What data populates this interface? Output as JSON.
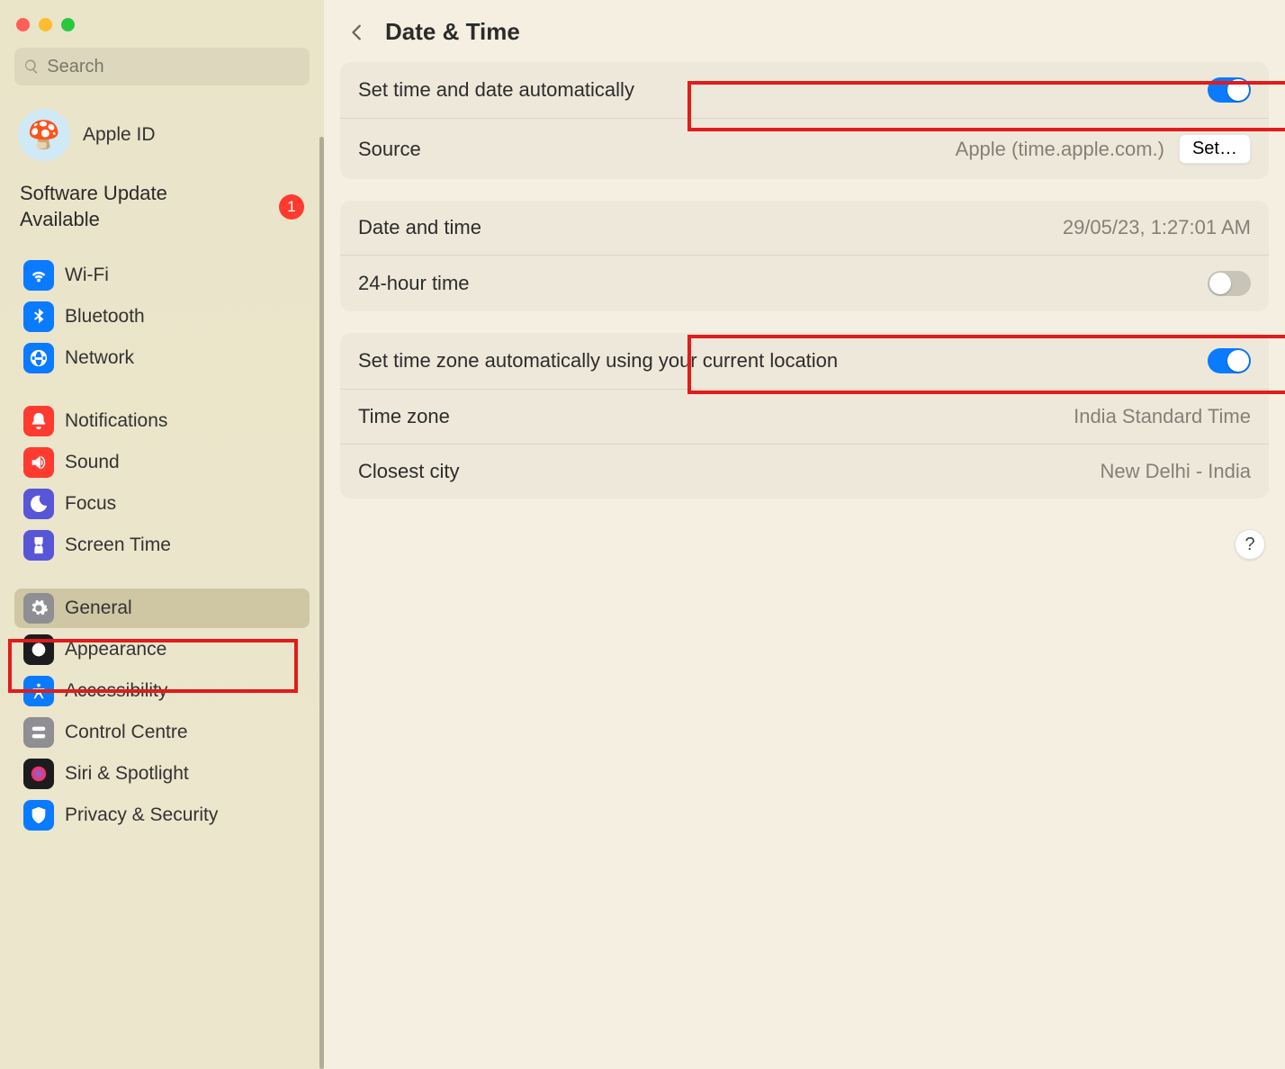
{
  "search": {
    "placeholder": "Search"
  },
  "account": {
    "label": "Apple ID",
    "avatar_emoji": "🍄"
  },
  "software_update": {
    "text": "Software Update Available",
    "count": "1"
  },
  "sidebar": {
    "items": [
      {
        "label": "Wi-Fi",
        "name": "wifi",
        "color": "#0a7aff"
      },
      {
        "label": "Bluetooth",
        "name": "bluetooth",
        "color": "#0a7aff"
      },
      {
        "label": "Network",
        "name": "network",
        "color": "#0a7aff"
      },
      {
        "label": "Notifications",
        "name": "notifications",
        "color": "#ff3b30"
      },
      {
        "label": "Sound",
        "name": "sound",
        "color": "#ff3b30"
      },
      {
        "label": "Focus",
        "name": "focus",
        "color": "#5856d6"
      },
      {
        "label": "Screen Time",
        "name": "screen-time",
        "color": "#5856d6"
      },
      {
        "label": "General",
        "name": "general",
        "color": "#8e8e93",
        "selected": true
      },
      {
        "label": "Appearance",
        "name": "appearance",
        "color": "#1c1c1e"
      },
      {
        "label": "Accessibility",
        "name": "accessibility",
        "color": "#0a7aff"
      },
      {
        "label": "Control Centre",
        "name": "control-centre",
        "color": "#8e8e93"
      },
      {
        "label": "Siri & Spotlight",
        "name": "siri",
        "color": "#1c1c1e"
      },
      {
        "label": "Privacy & Security",
        "name": "privacy",
        "color": "#0a7aff"
      }
    ]
  },
  "header": {
    "title": "Date & Time"
  },
  "group1": {
    "auto_time_label": "Set time and date automatically",
    "auto_time_on": true,
    "source_label": "Source",
    "source_value": "Apple (time.apple.com.)",
    "set_button": "Set…"
  },
  "group2": {
    "dt_label": "Date and time",
    "dt_value": "29/05/23, 1:27:01 AM",
    "h24_label": "24-hour time",
    "h24_on": false
  },
  "group3": {
    "auto_zone_label": "Set time zone automatically using your current location",
    "auto_zone_on": true,
    "zone_label": "Time zone",
    "zone_value": "India Standard Time",
    "city_label": "Closest city",
    "city_value": "New Delhi - India"
  },
  "help": "?"
}
